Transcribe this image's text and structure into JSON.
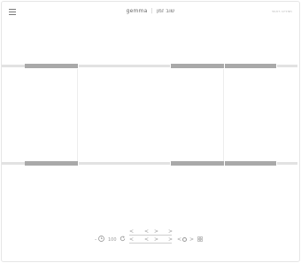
{
  "header": {
    "menu_icon": "hamburger-icon",
    "title_left": "gemma",
    "title_sep": "|",
    "title_right": "שוב זמן",
    "right_link": "תפריט ראשי"
  },
  "controls": {
    "row1": [
      "<",
      "<",
      ">",
      ">"
    ],
    "row2": {
      "minus_clock": "-",
      "clock_icon": "clock-icon",
      "speed": "100",
      "refresh_icon": "refresh-icon",
      "prev": "<",
      "prev2": "<",
      "next": ">",
      "small_prev": "<",
      "circle_icon": "circle-icon",
      "small_next": ">",
      "grid_icon": "grid-icon"
    }
  },
  "colors": {
    "light_segment": "#e2e2e2",
    "dark_segment": "#a9a9a9",
    "border": "#e6e6e6"
  }
}
